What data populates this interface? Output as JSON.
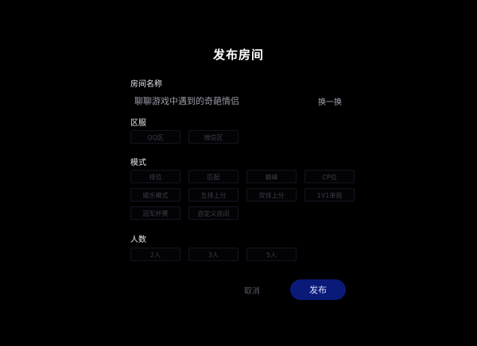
{
  "dialog": {
    "title": "发布房间",
    "room_name": {
      "label": "房间名称",
      "value": "聊聊游戏中遇到的奇葩情侣",
      "swap_label": "换一换"
    },
    "region": {
      "label": "区服",
      "options": [
        "QQ区",
        "微信区"
      ]
    },
    "mode": {
      "label": "模式",
      "options": [
        "排位",
        "匹配",
        "巅峰",
        "CP位",
        "娱乐模式",
        "五排上分",
        "双排上分",
        "1V1单挑",
        "冠军杯赛",
        "自定义房间"
      ]
    },
    "players": {
      "label": "人数",
      "options": [
        "2人",
        "3人",
        "5人"
      ]
    },
    "cancel_label": "取消",
    "publish_label": "发布"
  },
  "colors": {
    "background": "#000000",
    "publish_button": "#0a1a78"
  }
}
